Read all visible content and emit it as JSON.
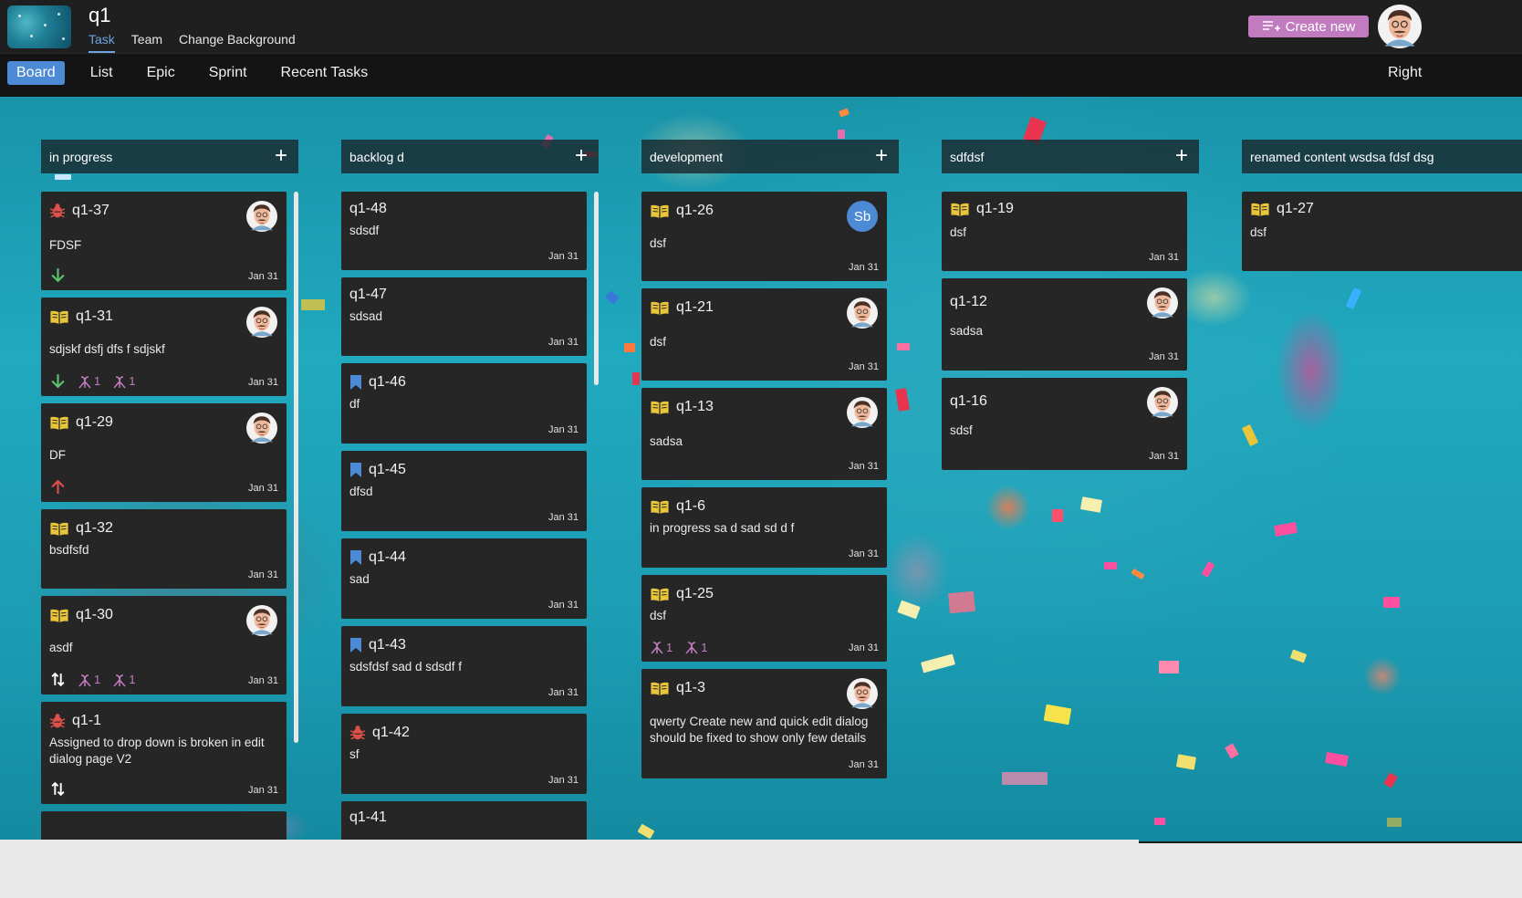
{
  "header": {
    "project_title": "q1",
    "tabs": [
      {
        "label": "Task",
        "active": true
      },
      {
        "label": "Team",
        "active": false
      },
      {
        "label": "Change Background",
        "active": false
      }
    ],
    "create_label": "Create new"
  },
  "subnav": {
    "items": [
      {
        "label": "Board",
        "active": true
      },
      {
        "label": "List",
        "active": false
      },
      {
        "label": "Epic",
        "active": false
      },
      {
        "label": "Sprint",
        "active": false
      },
      {
        "label": "Recent Tasks",
        "active": false
      }
    ],
    "right_label": "Right"
  },
  "colors": {
    "accent": "#4d8ad6",
    "create": "#c07cbf",
    "card": "#262626",
    "bug": "#e0504a",
    "story": "#e8c53a",
    "task": "#4d8ad6",
    "priority_low": "#5cc46b",
    "priority_high": "#e0504a"
  },
  "columns": [
    {
      "title": "in progress",
      "add_label": "+",
      "cards": [
        {
          "key": "q1-37",
          "type_icon": "bug-icon",
          "desc": "FDSF",
          "date": "Jan 31",
          "avatar": true,
          "priority": "arrow-down-icon",
          "subtasks": []
        },
        {
          "key": "q1-31",
          "type_icon": "book-icon",
          "desc": "sdjskf dsfj dfs f sdjskf",
          "date": "Jan 31",
          "avatar": true,
          "priority": "arrow-down-icon",
          "subtasks": [
            "1",
            "1"
          ]
        },
        {
          "key": "q1-29",
          "type_icon": "book-icon",
          "desc": "DF",
          "date": "Jan 31",
          "avatar": true,
          "priority": "arrow-up-icon",
          "subtasks": []
        },
        {
          "key": "q1-32",
          "type_icon": "book-icon",
          "desc": "bsdfsfd",
          "date": "Jan 31",
          "avatar": false,
          "priority": "",
          "subtasks": []
        },
        {
          "key": "q1-30",
          "type_icon": "book-icon",
          "desc": "asdf",
          "date": "Jan 31",
          "avatar": true,
          "priority": "updown-icon",
          "subtasks": [
            "1",
            "1"
          ]
        },
        {
          "key": "q1-1",
          "type_icon": "bug-icon",
          "desc": "Assigned to drop down is broken in edit dialog page V2",
          "date": "Jan 31",
          "avatar": false,
          "priority": "updown-icon",
          "subtasks": []
        }
      ]
    },
    {
      "title": "backlog d",
      "add_label": "+",
      "cards": [
        {
          "key": "q1-48",
          "type_icon": "",
          "desc": "sdsdf",
          "date": "Jan 31"
        },
        {
          "key": "q1-47",
          "type_icon": "",
          "desc": "sdsad",
          "date": "Jan 31"
        },
        {
          "key": "q1-46",
          "type_icon": "bookmark-icon",
          "desc": "df",
          "date": "Jan 31"
        },
        {
          "key": "q1-45",
          "type_icon": "bookmark-icon",
          "desc": "dfsd",
          "date": "Jan 31"
        },
        {
          "key": "q1-44",
          "type_icon": "bookmark-icon",
          "desc": "sad",
          "date": "Jan 31"
        },
        {
          "key": "q1-43",
          "type_icon": "bookmark-icon",
          "desc": "sdsfdsf sad d sdsdf f",
          "date": "Jan 31"
        },
        {
          "key": "q1-42",
          "type_icon": "bug-icon",
          "desc": "sf",
          "date": "Jan 31"
        },
        {
          "key": "q1-41",
          "type_icon": "",
          "desc": "",
          "date": ""
        }
      ]
    },
    {
      "title": "development",
      "add_label": "+",
      "cards": [
        {
          "key": "q1-26",
          "type_icon": "book-icon",
          "desc": "dsf",
          "date": "Jan 31",
          "initials": "Sb"
        },
        {
          "key": "q1-21",
          "type_icon": "book-icon",
          "desc": "dsf",
          "date": "Jan 31"
        },
        {
          "key": "q1-13",
          "type_icon": "book-icon",
          "desc": "sadsa",
          "date": "Jan 31"
        },
        {
          "key": "q1-6",
          "type_icon": "book-icon",
          "desc": "in progress sa d sad sd d f",
          "date": "Jan 31"
        },
        {
          "key": "q1-25",
          "type_icon": "book-icon",
          "desc": "dsf",
          "date": "Jan 31",
          "subtasks": [
            "1",
            "1"
          ]
        },
        {
          "key": "q1-3",
          "type_icon": "book-icon",
          "desc": "qwerty Create new and quick edit dialog should be fixed to show only few details",
          "date": "Jan 31"
        }
      ]
    },
    {
      "title": "sdfdsf",
      "add_label": "+",
      "cards": [
        {
          "key": "q1-19",
          "type_icon": "book-icon",
          "desc": "dsf",
          "date": "Jan 31"
        },
        {
          "key": "q1-12",
          "type_icon": "",
          "desc": "sadsa",
          "date": "Jan 31"
        },
        {
          "key": "q1-16",
          "type_icon": "",
          "desc": "sdsf",
          "date": "Jan 31"
        }
      ]
    },
    {
      "title": "renamed content wsdsa fdsf dsg",
      "cards": [
        {
          "key": "q1-27",
          "type_icon": "book-icon",
          "desc": "dsf",
          "date": ""
        }
      ]
    }
  ]
}
